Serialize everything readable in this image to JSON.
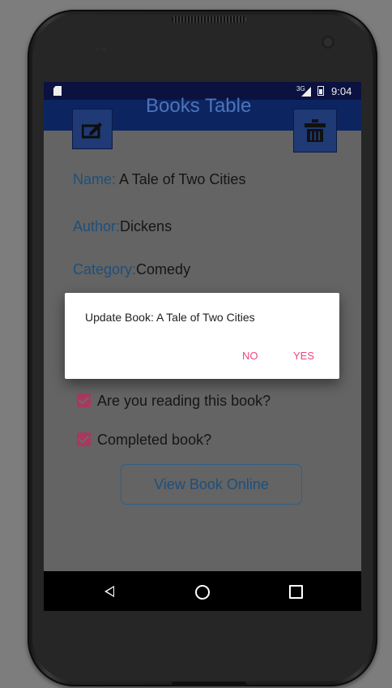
{
  "status_bar": {
    "network": "3G",
    "time": "9:04"
  },
  "app_bar": {
    "title": "Books Table"
  },
  "book": {
    "name_label": "Name:",
    "name_value": " A Tale of Two Cities",
    "author_label": "Author:",
    "author_value": "Dickens",
    "category_label": "Category:",
    "category_value": "Comedy"
  },
  "checkboxes": [
    {
      "label": "Are you reading this book?",
      "checked": true
    },
    {
      "label": "Completed book?",
      "checked": true
    }
  ],
  "view_online_button": "View Book Online",
  "dialog": {
    "message": "Update Book: A Tale of Two Cities",
    "negative": "NO",
    "positive": "YES"
  },
  "colors": {
    "accent": "#f0457f",
    "app_bar": "#0c2561",
    "label": "#1d4f7c",
    "checkbox": "#a8385f"
  },
  "icons": {
    "edit": "edit-icon",
    "delete": "trash-icon",
    "back": "back-icon",
    "home": "home-icon",
    "recents": "recents-icon"
  }
}
